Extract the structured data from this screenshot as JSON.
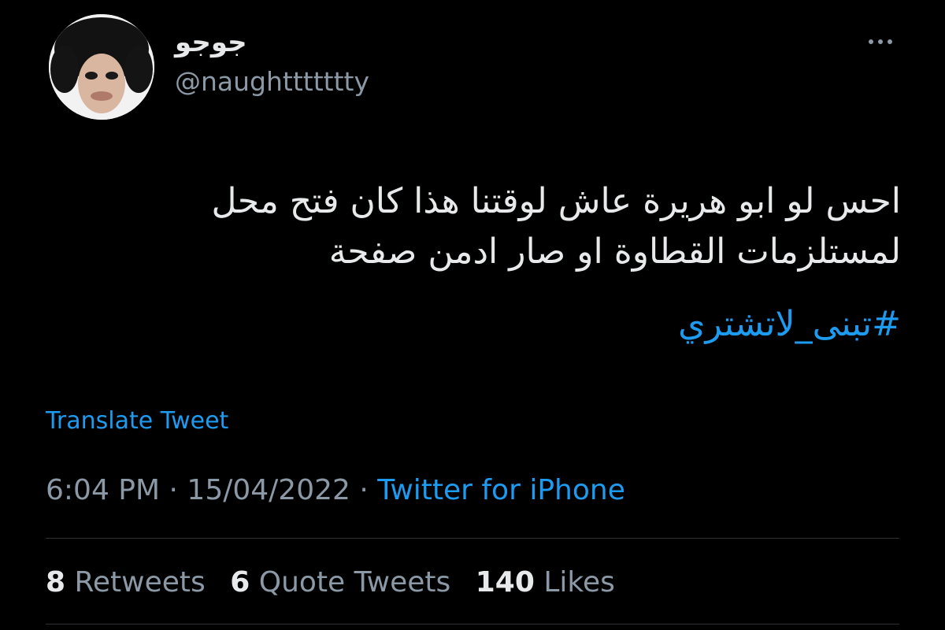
{
  "colors": {
    "background": "#000000",
    "text": "#e7e9ea",
    "secondary": "#8b98a5",
    "accent": "#1d9bf0",
    "divider": "#2f3336"
  },
  "author": {
    "display_name": "جوجو",
    "handle": "@naughttttttty",
    "avatar_icon": "profile-photo"
  },
  "more_icon": "more-horizontal-icon",
  "tweet": {
    "text_lines": [
      "احس لو ابو هريرة عاش لوقتنا هذا كان فتح محل",
      "لمستلزمات القطاوة او صار ادمن صفحة"
    ],
    "hashtag": "#تبنى_لاتشتري",
    "translate_label": "Translate Tweet",
    "time": "6:04 PM",
    "date": "15/04/2022",
    "separator": "·",
    "source": "Twitter for iPhone"
  },
  "stats": {
    "retweets_count": "8",
    "retweets_label": "Retweets",
    "quotes_count": "6",
    "quotes_label": "Quote Tweets",
    "likes_count": "140",
    "likes_label": "Likes"
  }
}
